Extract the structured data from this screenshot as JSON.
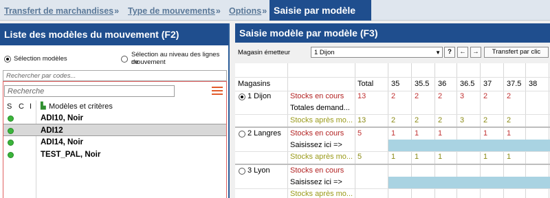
{
  "nav": {
    "crumbs": [
      "Transfert de marchandises",
      "Type de mouvements",
      "Options"
    ],
    "separator": "»",
    "active": "Saisie par modèle"
  },
  "left": {
    "title": "Liste des modèles du mouvement (F2)",
    "radio1": "Sélection modèles",
    "radio2_line1": "Sélection au niveau des lignes de",
    "radio2_line2": "mouvement",
    "codes_placeholder": "Rechercher par codes...",
    "search_placeholder": "Recherche",
    "columns": [
      "S",
      "C",
      "I"
    ],
    "models_header": "Modèles et critères",
    "models": [
      {
        "label": "ADI10, Noir"
      },
      {
        "label": "ADI12"
      },
      {
        "label": "ADI14, Noir"
      },
      {
        "label": "TEST_PAL, Noir"
      }
    ]
  },
  "right": {
    "title": "Saisie modèle par modèle (F3)",
    "magasin_label": "Magasin émetteur",
    "magasin_value": "1 Dijon",
    "help_btn": "?",
    "prev_btn": "←",
    "next_btn": "→",
    "transfer_btn": "Transfert par clic",
    "grid": {
      "col_magasins": "Magasins",
      "col_total": "Total",
      "sizes": [
        "35",
        "35.5",
        "36",
        "36.5",
        "37",
        "37.5",
        "38"
      ],
      "stores": [
        {
          "name": "1 Dijon",
          "selected": true,
          "rows": [
            {
              "label": "Stocks en cours",
              "total": "13",
              "values": [
                "2",
                "2",
                "2",
                "3",
                "2",
                "2",
                ""
              ]
            },
            {
              "label": "Totales demand...",
              "total": "",
              "values": [
                "",
                "",
                "",
                "",
                "",
                "",
                ""
              ]
            },
            {
              "label": "Stocks après mo...",
              "total": "13",
              "values": [
                "2",
                "2",
                "2",
                "3",
                "2",
                "2",
                ""
              ]
            }
          ]
        },
        {
          "name": "2 Langres",
          "selected": false,
          "rows": [
            {
              "label": "Stocks en cours",
              "total": "5",
              "values": [
                "1",
                "1",
                "1",
                "",
                "1",
                "1",
                ""
              ]
            },
            {
              "label": "Saisissez ici  =>",
              "total": "",
              "values": [
                "",
                "",
                "",
                "",
                "",
                "",
                ""
              ]
            },
            {
              "label": "Stocks après mo...",
              "total": "5",
              "values": [
                "1",
                "1",
                "1",
                "",
                "1",
                "1",
                ""
              ]
            }
          ]
        },
        {
          "name": "3 Lyon",
          "selected": false,
          "rows": [
            {
              "label": "Stocks en cours",
              "total": "",
              "values": [
                "",
                "",
                "",
                "",
                "",
                "",
                ""
              ]
            },
            {
              "label": "Saisissez ici  =>",
              "total": "",
              "values": [
                "",
                "",
                "",
                "",
                "",
                "",
                ""
              ]
            },
            {
              "label": "Stocks après mo...",
              "total": "",
              "values": [
                "",
                "",
                "",
                "",
                "",
                "",
                ""
              ]
            }
          ]
        }
      ]
    }
  }
}
